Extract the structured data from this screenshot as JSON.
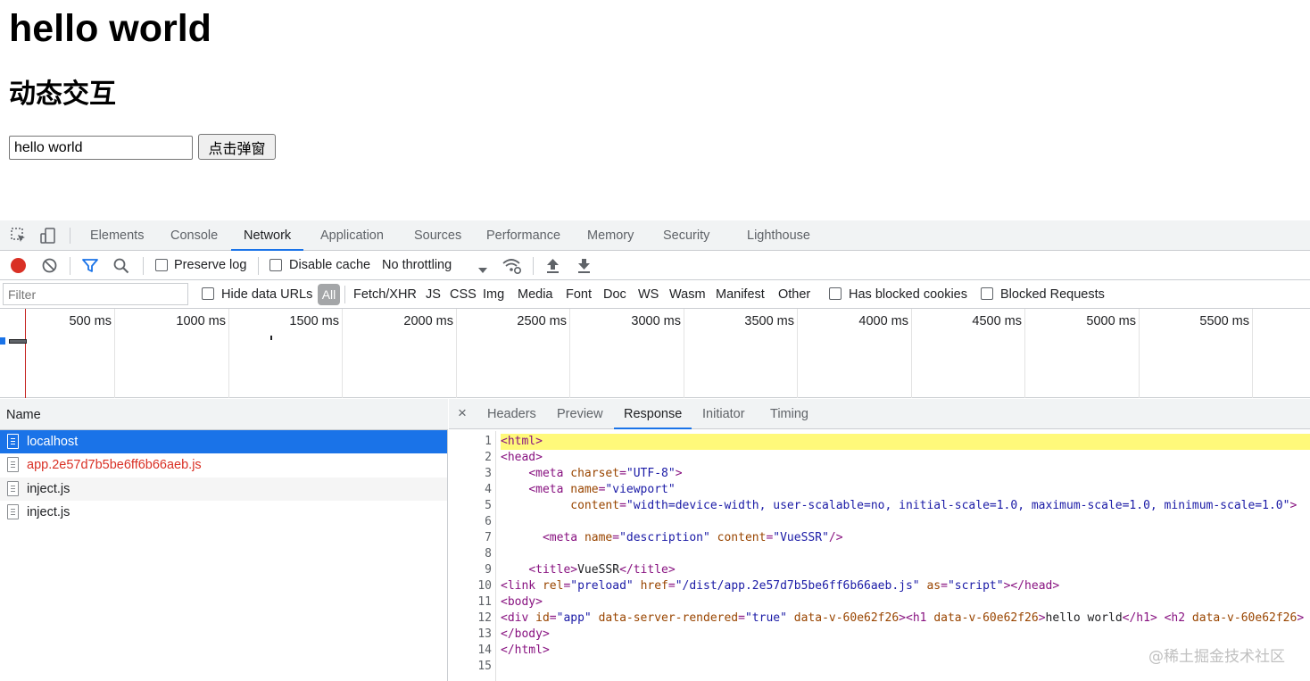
{
  "page": {
    "heading": "hello world",
    "subheading": "动态交互",
    "input_value": "hello world",
    "button_label": "点击弹窗"
  },
  "devtools": {
    "tabs": [
      "Elements",
      "Console",
      "Network",
      "Application",
      "Sources",
      "Performance",
      "Memory",
      "Security",
      "Lighthouse"
    ],
    "active_tab": "Network",
    "toolbar": {
      "preserve_log": "Preserve log",
      "disable_cache": "Disable cache",
      "throttling": "No throttling"
    },
    "filter": {
      "placeholder": "Filter",
      "hide_data_urls": "Hide data URLs",
      "all": "All",
      "types": [
        "Fetch/XHR",
        "JS",
        "CSS",
        "Img",
        "Media",
        "Font",
        "Doc",
        "WS",
        "Wasm",
        "Manifest",
        "Other"
      ],
      "has_blocked_cookies": "Has blocked cookies",
      "blocked_requests": "Blocked Requests"
    },
    "timeline": {
      "labels": [
        "500 ms",
        "1000 ms",
        "1500 ms",
        "2000 ms",
        "2500 ms",
        "3000 ms",
        "3500 ms",
        "4000 ms",
        "4500 ms",
        "5000 ms",
        "5500 ms"
      ]
    },
    "requests": {
      "header": "Name",
      "items": [
        {
          "name": "localhost",
          "state": "selected"
        },
        {
          "name": "app.2e57d7b5be6ff6b66aeb.js",
          "state": "error"
        },
        {
          "name": "inject.js",
          "state": "normal"
        },
        {
          "name": "inject.js",
          "state": "normal"
        }
      ]
    },
    "detail": {
      "close": "×",
      "tabs": [
        "Headers",
        "Preview",
        "Response",
        "Initiator",
        "Timing"
      ],
      "active_tab": "Response",
      "line_numbers": [
        "1",
        "2",
        "3",
        "4",
        "5",
        "6",
        "7",
        "8",
        "9",
        "10",
        "11",
        "12",
        "13",
        "14",
        "15"
      ]
    }
  },
  "watermark": "@稀土掘金技术社区",
  "colors": {
    "accent": "#1a73e8",
    "record_red": "#d93025",
    "highlight": "#fff97a"
  }
}
